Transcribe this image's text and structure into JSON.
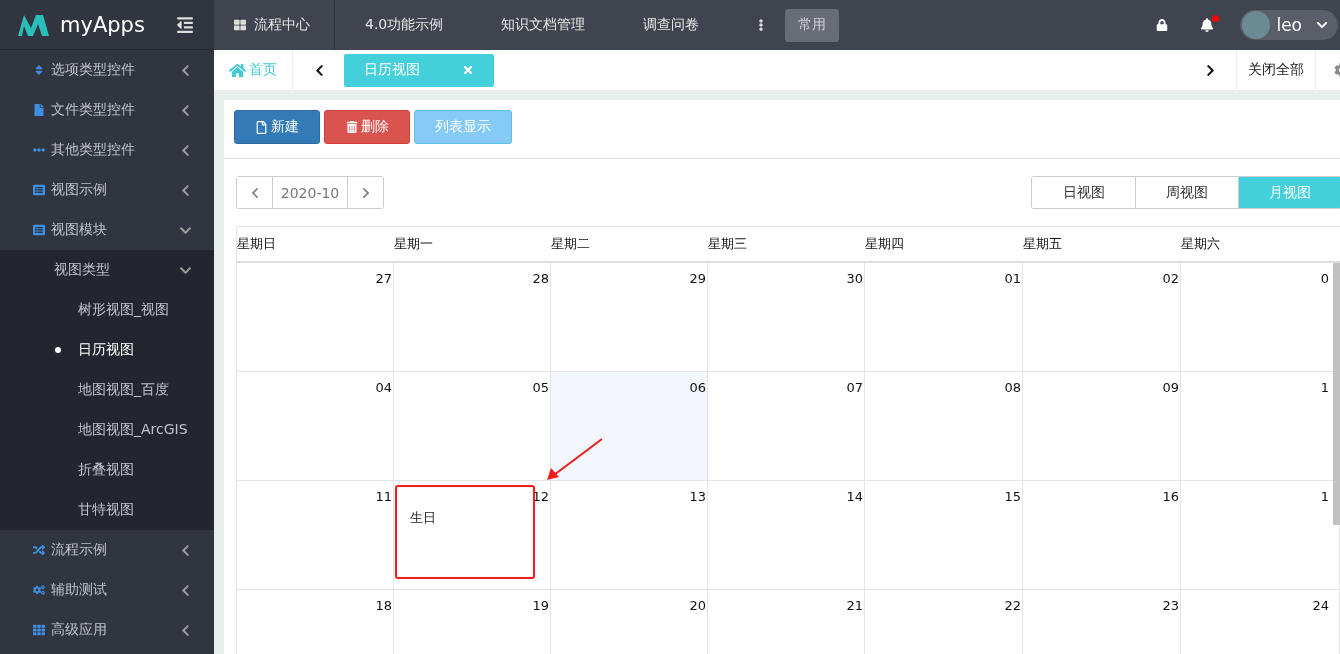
{
  "brand": {
    "name": "myApps"
  },
  "top_nav": {
    "items": [
      {
        "label": "流程中心"
      },
      {
        "label": "4.0功能示例"
      },
      {
        "label": "知识文档管理"
      },
      {
        "label": "调查问卷"
      }
    ],
    "common_button": "常用",
    "user": {
      "name": "leo",
      "unread": true
    }
  },
  "tab_bar": {
    "home": "首页",
    "tabs": [
      {
        "label": "日历视图",
        "selected": true
      }
    ],
    "close_all": "关闭全部"
  },
  "sidebar": {
    "items": [
      {
        "label": "选项类型控件",
        "expanded": false
      },
      {
        "label": "文件类型控件",
        "expanded": false
      },
      {
        "label": "其他类型控件",
        "expanded": false
      },
      {
        "label": "视图示例",
        "expanded": false
      },
      {
        "label": "视图模块",
        "expanded": true,
        "children": [
          {
            "label": "视图类型",
            "expanded": true,
            "children": [
              {
                "label": "树形视图_视图",
                "selected": false
              },
              {
                "label": "日历视图",
                "selected": true
              },
              {
                "label": "地图视图_百度",
                "selected": false
              },
              {
                "label": "地图视图_ArcGIS",
                "selected": false
              },
              {
                "label": "折叠视图",
                "selected": false
              },
              {
                "label": "甘特视图",
                "selected": false
              }
            ]
          }
        ]
      },
      {
        "label": "流程示例",
        "expanded": false
      },
      {
        "label": "辅助测试",
        "expanded": false
      },
      {
        "label": "高级应用",
        "expanded": false
      }
    ]
  },
  "toolbar": {
    "buttons": [
      {
        "label": "新建",
        "kind": "new"
      },
      {
        "label": "删除",
        "kind": "delete"
      },
      {
        "label": "列表显示",
        "kind": "list"
      }
    ]
  },
  "calendar": {
    "month": "2020-10",
    "views": [
      {
        "label": "日视图",
        "selected": false
      },
      {
        "label": "周视图",
        "selected": false
      },
      {
        "label": "月视图",
        "selected": true
      }
    ],
    "weekdays": [
      "星期日",
      "星期一",
      "星期二",
      "星期三",
      "星期四",
      "星期五",
      "星期六"
    ],
    "weeks": [
      [
        {
          "date": "27",
          "today": false
        },
        {
          "date": "28",
          "today": false
        },
        {
          "date": "29",
          "today": false
        },
        {
          "date": "30",
          "today": false
        },
        {
          "date": "01",
          "today": false
        },
        {
          "date": "02",
          "today": false
        },
        {
          "date": "0",
          "today": false
        }
      ],
      [
        {
          "date": "04",
          "today": false
        },
        {
          "date": "05",
          "today": false
        },
        {
          "date": "06",
          "today": true
        },
        {
          "date": "07",
          "today": false
        },
        {
          "date": "08",
          "today": false
        },
        {
          "date": "09",
          "today": false
        },
        {
          "date": "1",
          "today": false
        }
      ],
      [
        {
          "date": "11",
          "today": false
        },
        {
          "date": "12",
          "today": false,
          "events": [
            {
              "title": "生日",
              "highlighted": true
            }
          ]
        },
        {
          "date": "13",
          "today": false
        },
        {
          "date": "14",
          "today": false
        },
        {
          "date": "15",
          "today": false
        },
        {
          "date": "16",
          "today": false
        },
        {
          "date": "1",
          "today": false
        }
      ],
      [
        {
          "date": "18",
          "today": false
        },
        {
          "date": "19",
          "today": false
        },
        {
          "date": "20",
          "today": false
        },
        {
          "date": "21",
          "today": false
        },
        {
          "date": "22",
          "today": false
        },
        {
          "date": "23",
          "today": false
        },
        {
          "date": "24",
          "today": false
        }
      ]
    ]
  }
}
